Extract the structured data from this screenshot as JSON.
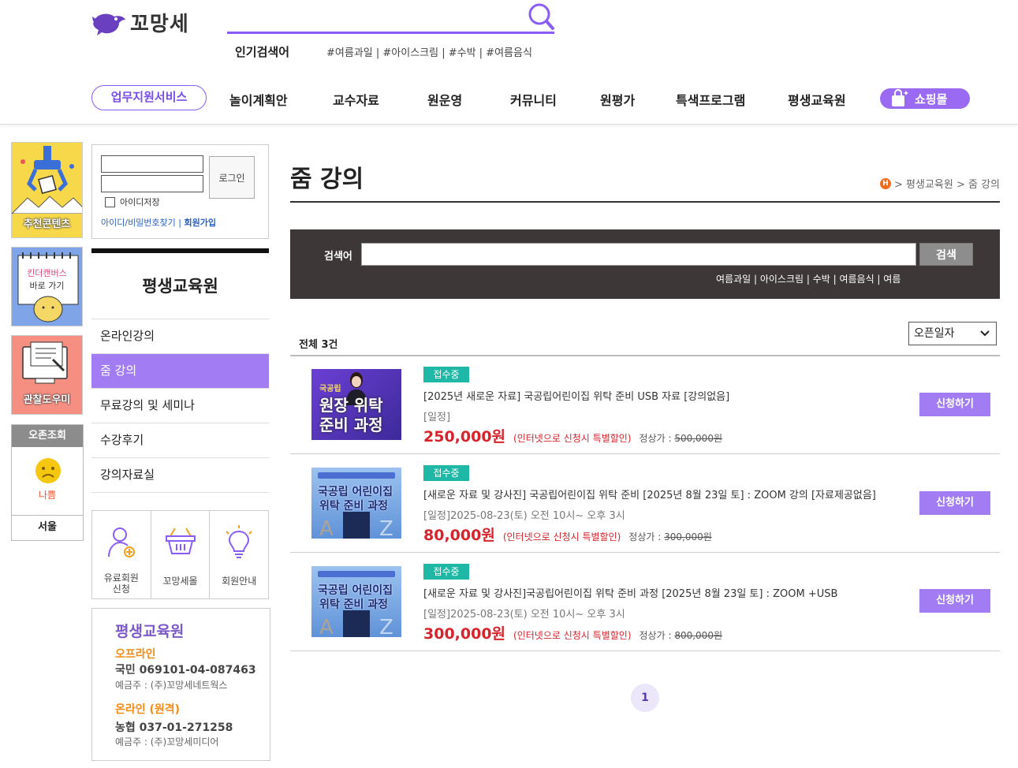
{
  "header": {
    "logo_text": "꼬망세",
    "popular_label": "인기검색어",
    "popular_tags": "#여름과일 | #아이스크림 | #수박 | #여름음식"
  },
  "gnb": {
    "highlight": "업무지원서비스",
    "items": [
      "놀이계획안",
      "교수자료",
      "원운영",
      "커뮤니티",
      "원평가",
      "특색프로그램",
      "평생교육원"
    ],
    "shop": "쇼핑몰"
  },
  "banners": {
    "recommend": "추천콘텐츠",
    "kinder_line1": "킨더캔버스",
    "kinder_line2": "바로 가기",
    "observe": "관찰도우미"
  },
  "weather": {
    "title": "오존조회",
    "status": "나쁨",
    "city": "서울"
  },
  "login": {
    "button": "로그인",
    "save_id": "아이디저장",
    "find": "아이디/비밀번호찾기 |",
    "join": "회원가입"
  },
  "sidemenu": {
    "title": "평생교육원",
    "items": [
      "온라인강의",
      "줌 강의",
      "무료강의 및 세미나",
      "수강후기",
      "강의자료실"
    ]
  },
  "quick": {
    "paid_line1": "유료회원",
    "paid_line2": "신청",
    "shop": "꼬망세몰",
    "guide": "회원안내"
  },
  "bank": {
    "title": "평생교육원",
    "offline": "오프라인",
    "offline_account": "국민 069101-04-087463",
    "offline_holder": "예금주 : (주)꼬망세네트웍스",
    "online": "온라인 (원격)",
    "online_account": "농협 037-01-271258",
    "online_holder": "예금주 : (주)꼬망세미디어"
  },
  "main": {
    "title": "줌 강의",
    "breadcrumb_home": "H",
    "breadcrumb": "> 평생교육원 > 줌 강의",
    "search_label": "검색어",
    "search_button": "검색",
    "search_tags": "여름과일 | 아이스크림 | 수박 | 여름음식 | 여름",
    "total": "전체 3건",
    "sort": "오픈일자",
    "page": "1"
  },
  "rows": [
    {
      "badge": "접수중",
      "title": "[2025년 새로운 자료] 국공립어린이집 위탁 준비 USB 자료 [강의없음]",
      "date": "[일정]",
      "price": "250,000원",
      "note": "(인터넷으로 신청시 특별할인)",
      "orig_label": "정상가 :",
      "orig": "500,000원",
      "apply": "신청하기",
      "thumb_small": "국공립",
      "thumb_l1": "원장 위탁",
      "thumb_l2": "준비 과정"
    },
    {
      "badge": "접수중",
      "title": "[새로운 자료 및 강사진] 국공립어린이집 위탁 준비 [2025년 8월 23일 토] : ZOOM 강의 [자료제공없음]",
      "date": "[일정]2025-08-23(토) 오전 10시~ 오후 3시",
      "price": "80,000원",
      "note": "(인터넷으로 신청시 특별할인)",
      "orig_label": "정상가 :",
      "orig": "300,000원",
      "apply": "신청하기",
      "thumb_l1": "국공립 어린이집",
      "thumb_l2": "위탁 준비 과정"
    },
    {
      "badge": "접수중",
      "title": "[새로운 자료 및 강사진]국공립어린이집 위탁 준비 과정 [2025년 8월 23일 토] : ZOOM +USB",
      "date": "[일정]2025-08-23(토) 오전 10시~ 오후 3시",
      "price": "300,000원",
      "note": "(인터넷으로 신청시 특별할인)",
      "orig_label": "정상가 :",
      "orig": "800,000원",
      "apply": "신청하기",
      "thumb_l1": "국공립 어린이집",
      "thumb_l2": "위탁 준비 과정"
    }
  ],
  "colors": {
    "accent": "#8a5cf5",
    "menu_active": "#a27cf2",
    "badge": "#1fb8a6",
    "price": "#d7232b"
  }
}
